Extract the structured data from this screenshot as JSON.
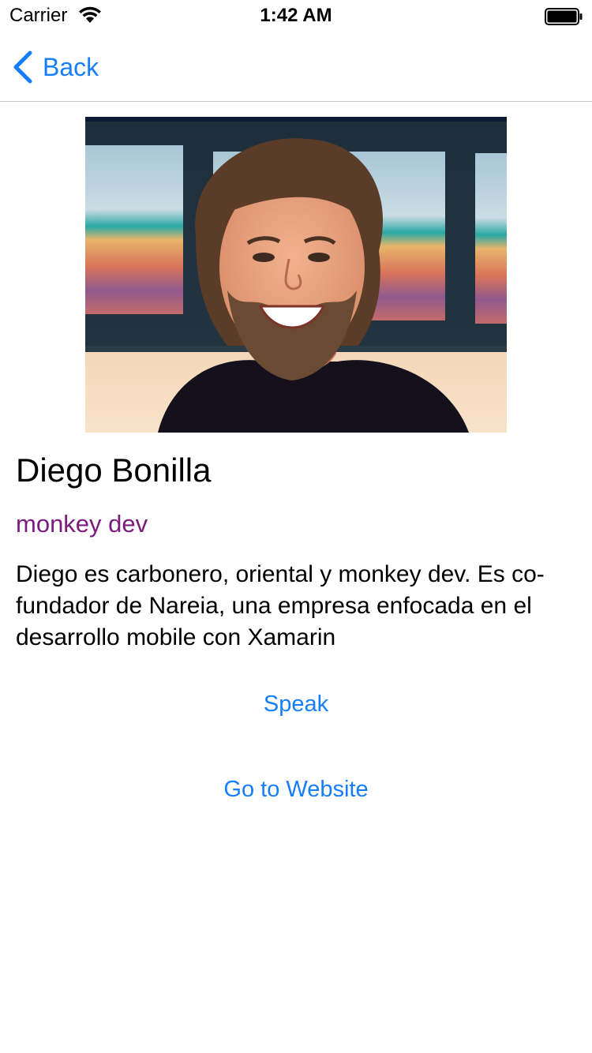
{
  "status_bar": {
    "carrier": "Carrier",
    "time": "1:42 AM",
    "icons": [
      "wifi-icon",
      "battery-icon"
    ]
  },
  "nav": {
    "back_label": "Back",
    "back_icon": "chevron-left-icon",
    "tint_color": "#157efb"
  },
  "speaker": {
    "name": "Diego Bonilla",
    "role": "monkey dev",
    "role_color": "#7b1b7e",
    "bio": "Diego es carbonero, oriental y monkey dev. Es co-fundador de Nareia, una empresa enfocada en el desarrollo mobile con Xamarin"
  },
  "actions": {
    "speak_label": "Speak",
    "website_label": "Go to Website"
  }
}
